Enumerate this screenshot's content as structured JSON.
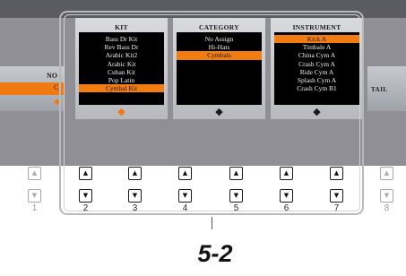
{
  "screen": {
    "left_label": "NO",
    "left_value": "C",
    "right_label": "TAIL"
  },
  "columns": [
    {
      "title": "KIT",
      "items": [
        "Bass Dr Kit",
        "Rev Bass Dr",
        "Arabic Kit2",
        "Arabic Kit",
        "Cuban Kit",
        "Pop Latin",
        "Cymbal Kit"
      ],
      "selected_index": 6,
      "stepper_icon": "orange-updown-arrows-icon"
    },
    {
      "title": "CATEGORY",
      "items": [
        "No Assign",
        "Hi-Hats",
        "Cymbals"
      ],
      "selected_index": 2,
      "stepper_icon": "updown-arrows-icon"
    },
    {
      "title": "INSTRUMENT",
      "items": [
        "Kick A",
        "Timbale A",
        "China Cym A",
        "Crash Cym A",
        "Ride Cym A",
        "Splash Cym A",
        "Crash Cym B1"
      ],
      "selected_index": 0,
      "stepper_icon": "updown-arrows-icon"
    }
  ],
  "buttons": {
    "numbers": [
      "1",
      "2",
      "3",
      "4",
      "5",
      "6",
      "7",
      "8"
    ],
    "up_glyph": "▲",
    "down_glyph": "▼"
  },
  "step_label": "5-2",
  "colors": {
    "accent": "#f07c12",
    "screen_bg": "#8f8f95",
    "list_bg": "#000000"
  }
}
